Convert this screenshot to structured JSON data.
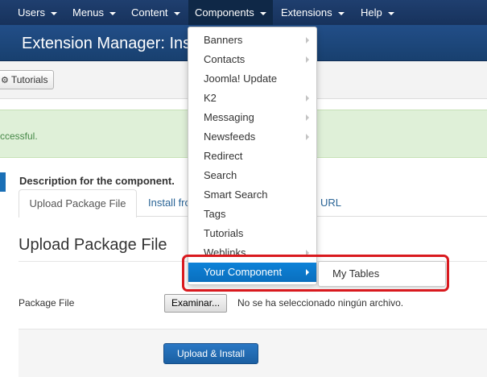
{
  "nav": {
    "items": [
      {
        "label": "Users"
      },
      {
        "label": "Menus"
      },
      {
        "label": "Content"
      },
      {
        "label": "Components"
      },
      {
        "label": "Extensions"
      },
      {
        "label": "Help"
      }
    ]
  },
  "header": {
    "title": "Extension Manager: Ins"
  },
  "toolbar": {
    "tutorials_label": "Tutorials",
    "tutorials_icon": "gear-icon"
  },
  "alert": {
    "text": "ccessful."
  },
  "content": {
    "description": "Description for the component.",
    "tabs": [
      {
        "label": "Upload Package File"
      },
      {
        "label": "Install fro"
      },
      {
        "label": "URL"
      }
    ],
    "section_title": "Upload Package File",
    "field_label": "Package File",
    "file_button_label": "Examinar...",
    "file_status": "No se ha seleccionado ningún archivo.",
    "submit_label": "Upload & Install"
  },
  "dropdown": {
    "items": [
      {
        "label": "Banners"
      },
      {
        "label": "Contacts"
      },
      {
        "label": "Joomla! Update"
      },
      {
        "label": "K2"
      },
      {
        "label": "Messaging"
      },
      {
        "label": "Newsfeeds"
      },
      {
        "label": "Redirect"
      },
      {
        "label": "Search"
      },
      {
        "label": "Smart Search"
      },
      {
        "label": "Tags"
      },
      {
        "label": "Tutorials"
      },
      {
        "label": "Weblinks"
      },
      {
        "label": "Your Component"
      }
    ],
    "submenu": [
      {
        "label": "My Tables"
      }
    ]
  },
  "colors": {
    "nav_bg": "#1a3867",
    "header_bg": "#1c4478",
    "highlight": "#0b79cc",
    "alert_bg": "#dff0d8",
    "annotation": "#d9191e"
  }
}
